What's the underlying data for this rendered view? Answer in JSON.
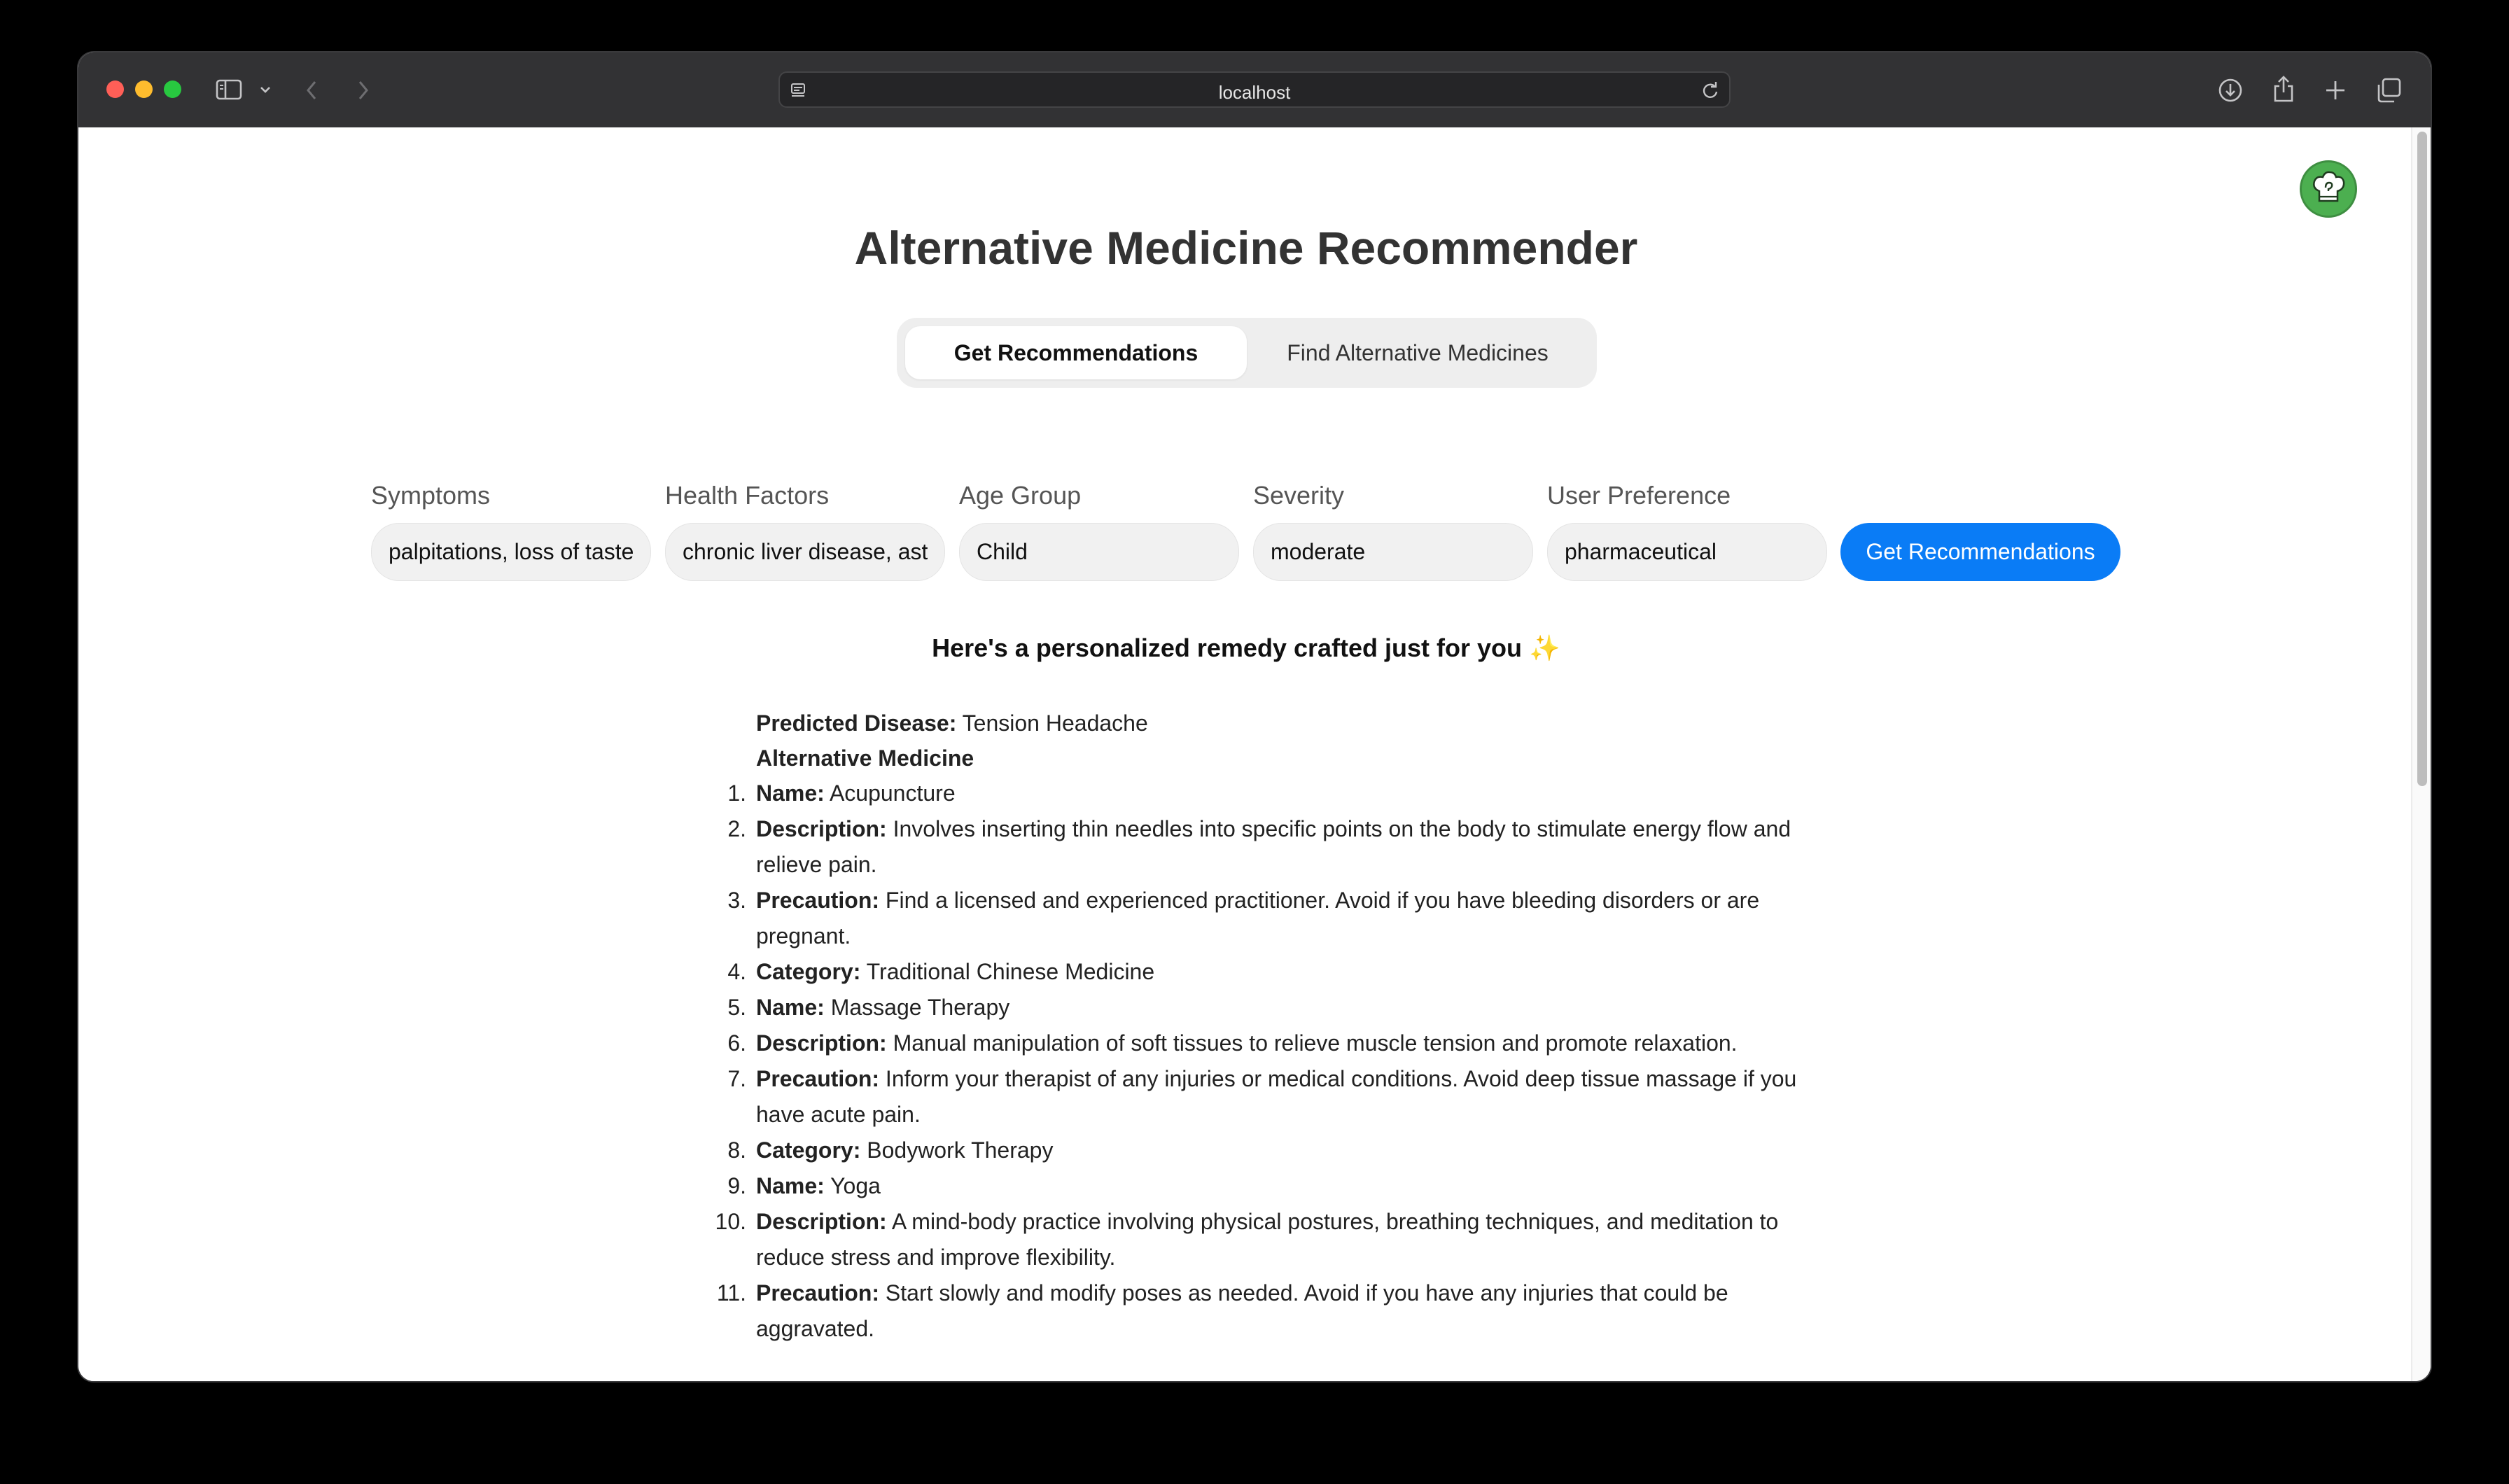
{
  "browser": {
    "url": "localhost",
    "icons": [
      "sidebar-icon",
      "chevron-down-icon",
      "back-icon",
      "forward-icon",
      "page-icon",
      "reload-icon",
      "download-icon",
      "share-icon",
      "new-tab-icon",
      "tabs-overview-icon"
    ]
  },
  "app": {
    "title": "Alternative Medicine Recommender",
    "tabs": [
      {
        "label": "Get Recommendations",
        "active": true
      },
      {
        "label": "Find Alternative Medicines",
        "active": false
      }
    ],
    "accent_color": "#0a7cf6"
  },
  "form": {
    "symptoms": {
      "label": "Symptoms",
      "value": "palpitations, loss of taste"
    },
    "health_factors": {
      "label": "Health Factors",
      "value": "chronic liver disease, asthma"
    },
    "age_group": {
      "label": "Age Group",
      "value": "Child"
    },
    "severity": {
      "label": "Severity",
      "value": "moderate"
    },
    "user_preference": {
      "label": "User Preference",
      "value": "pharmaceutical"
    },
    "submit_label": "Get Recommendations"
  },
  "result": {
    "heading": "Here's a personalized remedy crafted just for you ✨",
    "predicted_label": "Predicted Disease:",
    "predicted_value": "Tension Headache",
    "section_title": "Alternative Medicine",
    "items": [
      {
        "num": "1.",
        "key": "Name:",
        "text": "Acupuncture"
      },
      {
        "num": "2.",
        "key": "Description:",
        "text": "Involves inserting thin needles into specific points on the body to stimulate energy flow and relieve pain."
      },
      {
        "num": "3.",
        "key": "Precaution:",
        "text": "Find a licensed and experienced practitioner. Avoid if you have bleeding disorders or are pregnant."
      },
      {
        "num": "4.",
        "key": "Category:",
        "text": "Traditional Chinese Medicine"
      },
      {
        "num": "5.",
        "key": "Name:",
        "text": "Massage Therapy"
      },
      {
        "num": "6.",
        "key": "Description:",
        "text": "Manual manipulation of soft tissues to relieve muscle tension and promote relaxation."
      },
      {
        "num": "7.",
        "key": "Precaution:",
        "text": "Inform your therapist of any injuries or medical conditions. Avoid deep tissue massage if you have acute pain."
      },
      {
        "num": "8.",
        "key": "Category:",
        "text": "Bodywork Therapy"
      },
      {
        "num": "9.",
        "key": "Name:",
        "text": "Yoga"
      },
      {
        "num": "10.",
        "key": "Description:",
        "text": "A mind-body practice involving physical postures, breathing techniques, and meditation to reduce stress and improve flexibility."
      },
      {
        "num": "11.",
        "key": "Precaution:",
        "text": "Start slowly and modify poses as needed. Avoid if you have any injuries that could be aggravated."
      }
    ]
  }
}
